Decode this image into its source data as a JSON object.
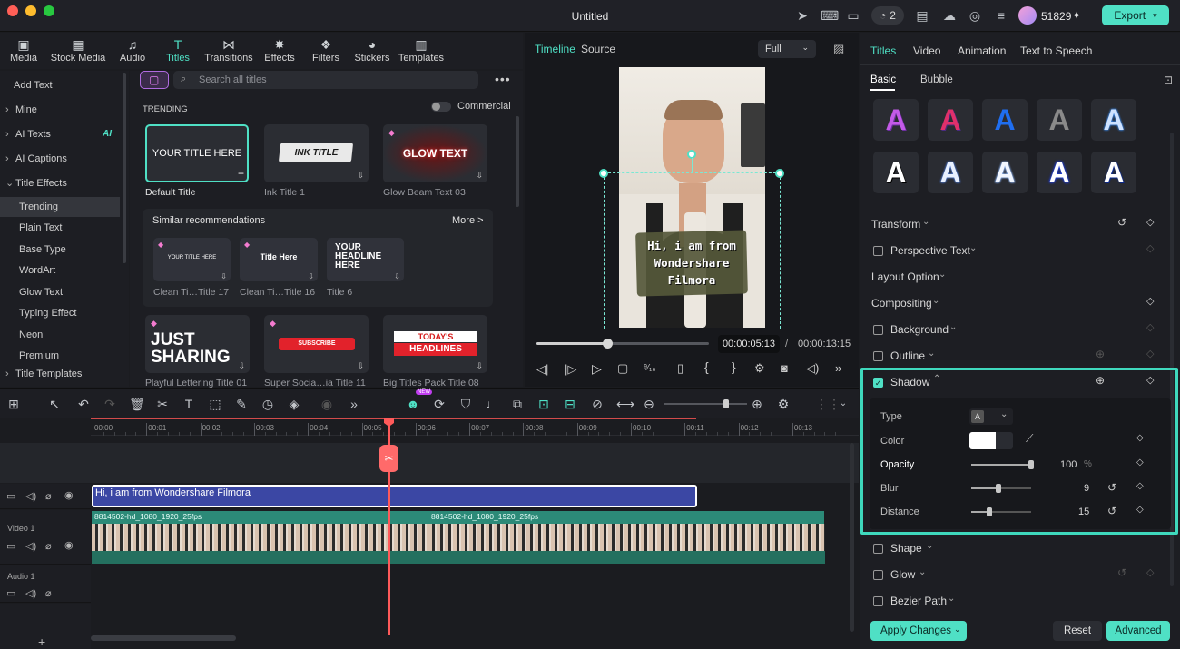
{
  "window": {
    "title": "Untitled",
    "credits": "51829",
    "export_label": "Export",
    "notif_count": "2"
  },
  "media_tabs": [
    {
      "label": "Media",
      "icon": "media-icon"
    },
    {
      "label": "Stock Media",
      "icon": "stock-media-icon"
    },
    {
      "label": "Audio",
      "icon": "audio-icon"
    },
    {
      "label": "Titles",
      "icon": "titles-icon"
    },
    {
      "label": "Transitions",
      "icon": "transitions-icon"
    },
    {
      "label": "Effects",
      "icon": "effects-icon"
    },
    {
      "label": "Filters",
      "icon": "filters-icon"
    },
    {
      "label": "Stickers",
      "icon": "stickers-icon"
    },
    {
      "label": "Templates",
      "icon": "templates-icon"
    }
  ],
  "left_nav": {
    "add_text": "Add Text",
    "items": [
      "Mine",
      "AI Texts",
      "AI Captions",
      "Title Effects"
    ],
    "ai_badge": "AI",
    "sub_items": [
      "Trending",
      "Plain Text",
      "Base Type",
      "WordArt",
      "Glow Text",
      "Typing Effect",
      "Neon",
      "Premium"
    ],
    "title_templates": "Title Templates"
  },
  "browser": {
    "search_placeholder": "Search all titles",
    "section": "TRENDING",
    "commercial_label": "Commercial",
    "cards": [
      {
        "text": "YOUR TITLE HERE",
        "label": "Default Title"
      },
      {
        "text": "INK TITLE",
        "label": "Ink Title 1"
      },
      {
        "text": "GLOW TEXT",
        "label": "Glow Beam Text 03"
      }
    ],
    "similar_title": "Similar recommendations",
    "more_label": "More >",
    "similar_cards": [
      {
        "text": "YOUR TITLE HERE",
        "label": "Clean Ti…Title 17"
      },
      {
        "text": "Title Here",
        "label": "Clean Ti…Title 16"
      },
      {
        "text": "YOUR HEADLINE HERE",
        "label": "Title 6"
      }
    ],
    "bottom_cards": [
      {
        "text1": "JUST",
        "text2": "SHARING",
        "label": "Playful Lettering Title 01"
      },
      {
        "text": "SUBSCRIBE",
        "label": "Super Socia…ia Title 11"
      },
      {
        "text1": "TODAY'S",
        "text2": "HEADLINES",
        "label": "Big Titles Pack Title 08"
      }
    ]
  },
  "preview": {
    "tabs": [
      "Timeline",
      "Source"
    ],
    "quality": "Full",
    "caption": "Hi, i am from Wondershare Filmora",
    "current_time": "00:00:05:13",
    "separator": "/",
    "total_time": "00:00:13:15",
    "progress": 0.41
  },
  "inspector": {
    "tabs": [
      "Titles",
      "Video",
      "Animation",
      "Text to Speech"
    ],
    "subtabs": [
      "Basic",
      "Bubble"
    ],
    "preset_letter": "A",
    "sections": {
      "transform": "Transform",
      "perspective": "Perspective Text",
      "layout": "Layout Option",
      "compositing": "Compositing",
      "background": "Background",
      "outline": "Outline",
      "shadow": "Shadow",
      "shape": "Shape",
      "glow": "Glow",
      "bezier": "Bezier Path"
    },
    "shadow": {
      "type_label": "Type",
      "type_value": "A",
      "color_label": "Color",
      "opacity_label": "Opacity",
      "opacity_value": "100",
      "opacity_unit": "%",
      "opacity": 1.0,
      "blur_label": "Blur",
      "blur_value": "9",
      "blur": 0.45,
      "distance_label": "Distance",
      "distance_value": "15",
      "distance": 0.3
    },
    "apply_label": "Apply Changes",
    "reset_label": "Reset",
    "advanced_label": "Advanced"
  },
  "timeline": {
    "ticks": [
      "00:00",
      "00:01",
      "00:02",
      "00:03",
      "00:04",
      "00:05",
      "00:06",
      "00:07",
      "00:08",
      "00:09",
      "00:10",
      "00:11",
      "00:12",
      "00:13"
    ],
    "title_clip": "Hi, i am from Wondershare Filmora",
    "video_clip_1": "8814502-hd_1080_1920_25fps",
    "video_clip_2": "8814502-hd_1080_1920_25fps",
    "video_track": "Video 1",
    "audio_track": "Audio 1",
    "zoom": 0.75,
    "new_badge": "NEW"
  },
  "colors": {
    "accent": "#4fe0c5",
    "title_clip": "#3b47a4",
    "video_clip": "#2c8a78"
  }
}
